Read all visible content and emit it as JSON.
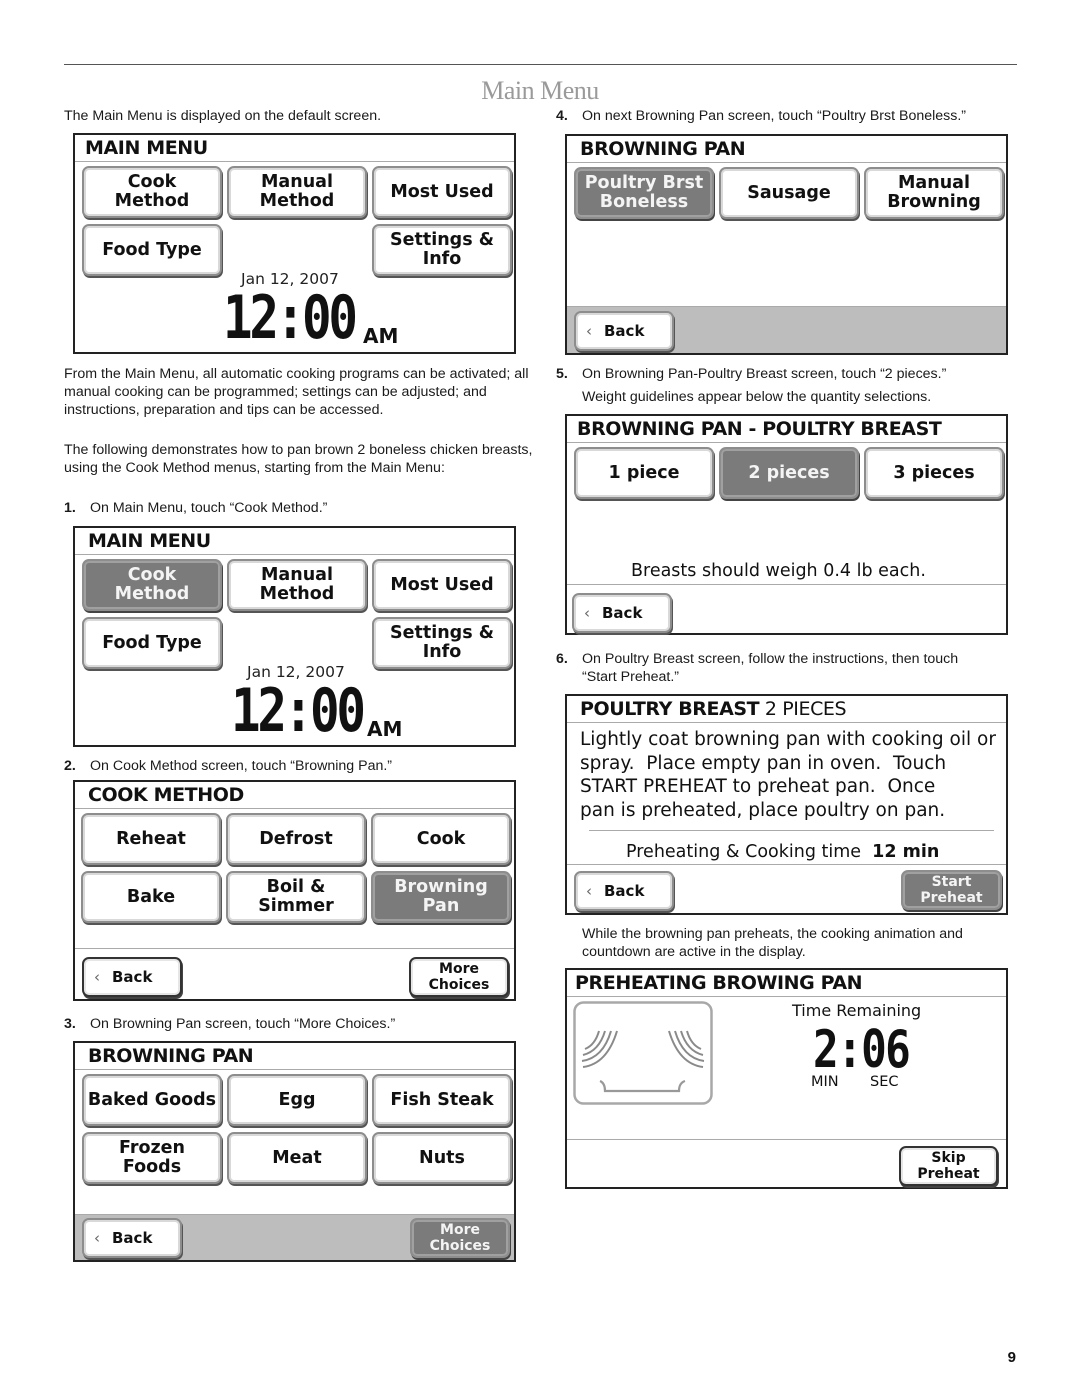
{
  "page": {
    "title": "Main Menu",
    "page_number": "9"
  },
  "left": {
    "intro": "The Main Menu is displayed on the default screen.",
    "para1": "From the Main Menu, all automatic cooking programs can be activated; all manual cooking can be programmed; settings can be adjusted; and instructions, preparation and tips can be accessed.",
    "para2": "The following demonstrates how to pan brown 2 boneless chicken breasts, using the Cook Method menus, starting from the Main Menu:",
    "steps": [
      {
        "num": "1.",
        "text": "On Main Menu, touch “Cook Method.”"
      },
      {
        "num": "2.",
        "text": "On Cook Method screen, touch “Browning Pan.”"
      },
      {
        "num": "3.",
        "text": "On Browning Pan screen, touch “More Choices.”"
      }
    ]
  },
  "right": {
    "steps": [
      {
        "num": "4.",
        "text": "On next Browning Pan screen, touch “Poultry Brst Boneless.”"
      },
      {
        "num": "5.",
        "text": "On Browning Pan-Poultry Breast screen, touch “2 pieces.”",
        "cont": "Weight guidelines appear below the quantity selections."
      },
      {
        "num": "6.",
        "text": "On Poultry Breast screen, follow the instructions, then touch",
        "cont": "“Start Preheat.”"
      }
    ],
    "note": "While the browning pan preheats, the cooking animation and countdown are active in the display."
  },
  "screens": {
    "main_menu_1": {
      "header": "MAIN MENU",
      "buttons": [
        "Cook\nMethod",
        "Manual\nMethod",
        "Most Used",
        "Food Type",
        "Settings &\nInfo"
      ],
      "date": "Jan 12, 2007",
      "time": "12:00",
      "ampm": "AM"
    },
    "main_menu_2": {
      "header": "MAIN MENU",
      "buttons": [
        "Cook\nMethod",
        "Manual\nMethod",
        "Most Used",
        "Food Type",
        "Settings &\nInfo"
      ],
      "selected": "Cook Method",
      "date": "Jan 12, 2007",
      "time": "12:00",
      "ampm": "AM"
    },
    "cook_method": {
      "header": "COOK METHOD",
      "buttons": [
        "Reheat",
        "Defrost",
        "Cook",
        "Bake",
        "Boil &\nSimmer",
        "Browning\nPan"
      ],
      "selected": "Browning Pan",
      "back": "Back",
      "more": "More\nChoices"
    },
    "browning_pan_1": {
      "header": "BROWNING PAN",
      "buttons": [
        "Baked Goods",
        "Egg",
        "Fish Steak",
        "Frozen\nFoods",
        "Meat",
        "Nuts"
      ],
      "back": "Back",
      "more": "More\nChoices",
      "selected": "More Choices"
    },
    "browning_pan_2": {
      "header": "BROWNING PAN",
      "buttons": [
        "Poultry Brst\nBoneless",
        "Sausage",
        "Manual\nBrowning"
      ],
      "selected": "Poultry Brst Boneless",
      "back": "Back"
    },
    "poultry_breast_qty": {
      "header": "BROWNING PAN - POULTRY BREAST",
      "buttons": [
        "1 piece",
        "2 pieces",
        "3 pieces"
      ],
      "selected": "2 pieces",
      "guideline": "Breasts should weigh 0.4 lb each.",
      "back": "Back"
    },
    "poultry_breast_instr": {
      "header_bold": "POULTRY BREAST",
      "header_light": " 2 PIECES",
      "instructions": [
        "Lightly coat browning pan with cooking oil or",
        "spray.  Place empty pan in oven.  Touch",
        "START PREHEAT to preheat pan.  Once",
        "pan is preheated, place poultry on pan."
      ],
      "time_label": "Preheating & Cooking time",
      "time_value": "12 min",
      "back": "Back",
      "start": "Start\nPreheat"
    },
    "preheating": {
      "header": "PREHEATING BROWING PAN",
      "time_remaining_label": "Time Remaining",
      "countdown": "2:06",
      "min_label": "MIN",
      "sec_label": "SEC",
      "skip": "Skip\nPreheat"
    }
  },
  "icons": {
    "back_chevron": "‹",
    "oven_animation": "browning-pan-oven-icon"
  }
}
